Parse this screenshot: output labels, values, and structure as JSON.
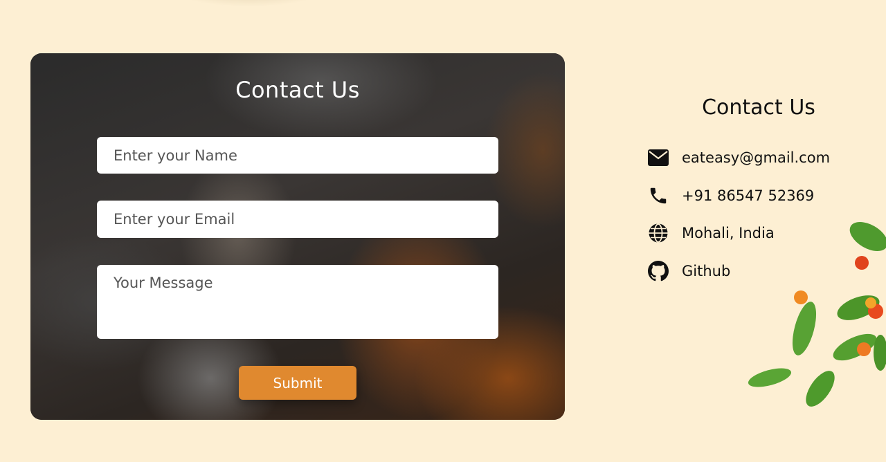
{
  "form": {
    "title": "Contact Us",
    "name_placeholder": "Enter your Name",
    "email_placeholder": "Enter your Email",
    "message_placeholder": "Your Message",
    "submit_label": "Submit"
  },
  "contact_info": {
    "title": "Contact Us",
    "items": [
      {
        "icon": "envelope-icon",
        "text": "eateasy@gmail.com"
      },
      {
        "icon": "phone-icon",
        "text": "+91 86547 52369"
      },
      {
        "icon": "globe-icon",
        "text": "Mohali, India"
      },
      {
        "icon": "github-icon",
        "text": "Github"
      }
    ]
  },
  "colors": {
    "page_background": "#fdefd3",
    "submit_button": "#e0892f",
    "input_background": "#ffffff"
  }
}
